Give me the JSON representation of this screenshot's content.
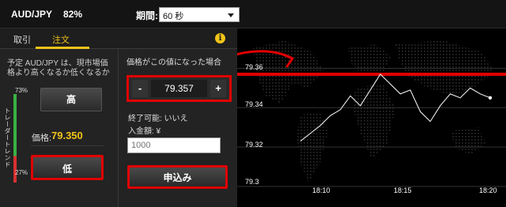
{
  "topbar": {
    "pair": "AUD/JPY",
    "percent": "82%",
    "period_label": "期間:",
    "period_value": "60 秒"
  },
  "tabs": {
    "buy": "取引",
    "order": "注文"
  },
  "predict_text": "予定 AUD/JPY は、現市場価格より高くなるか低くなるか",
  "trend": {
    "top_pct": "73%",
    "bottom_pct": "27%",
    "label": "トレーダートレンド",
    "up_fraction": 0.73
  },
  "buttons": {
    "high": "高",
    "low": "低",
    "apply": "申込み"
  },
  "price": {
    "label": "価格:",
    "value": "79.350"
  },
  "order": {
    "when_label": "価格がこの値になった場合",
    "stepper_minus": "-",
    "stepper_value": "79.357",
    "stepper_plus": "+",
    "settle_label": "終了可能: いいえ",
    "amount_label": "入金額: ¥",
    "amount_value": "1000"
  },
  "chart_data": {
    "type": "line",
    "yticks": [
      "79.36",
      "79.34",
      "79.32",
      "79.3"
    ],
    "xticks": [
      "18:10",
      "18:15",
      "18:20"
    ],
    "target_price": 79.357,
    "ylim": [
      79.3,
      79.365
    ],
    "series": [
      {
        "values": [
          79.323,
          79.327,
          79.331,
          79.336,
          79.339,
          79.346,
          79.341,
          79.349,
          79.357,
          79.352,
          79.347,
          79.349,
          79.338,
          79.333,
          79.341,
          79.347,
          79.345,
          79.35,
          79.347,
          79.345
        ]
      }
    ]
  },
  "colors": {
    "accent": "#f0c419",
    "highlight": "#e00000",
    "trend_up": "#3bb043",
    "trend_down": "#d83030"
  }
}
